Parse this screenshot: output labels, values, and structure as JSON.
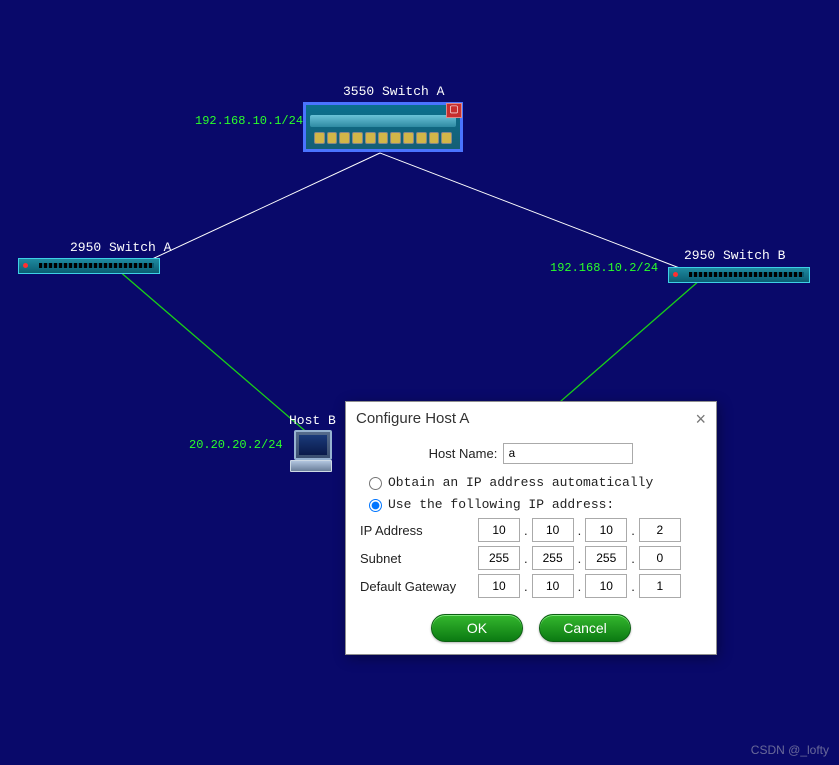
{
  "devices": {
    "sw3550": {
      "label": "3550 Switch A",
      "ip_label": "192.168.10.1/24"
    },
    "sw2950a": {
      "label": "2950 Switch A"
    },
    "sw2950b": {
      "label": "2950 Switch B",
      "ip_label": "192.168.10.2/24"
    },
    "hostb": {
      "label": "Host B",
      "ip_label": "20.20.20.2/24"
    }
  },
  "dialog": {
    "title": "Configure Host A",
    "hostname_label": "Host Name:",
    "hostname_value": "a",
    "radio_auto": "Obtain an IP address automatically",
    "radio_static": "Use the following IP address:",
    "ip_label": "IP Address",
    "subnet_label": "Subnet",
    "gateway_label": "Default Gateway",
    "ip": [
      "10",
      "10",
      "10",
      "2"
    ],
    "subnet": [
      "255",
      "255",
      "255",
      "0"
    ],
    "gateway": [
      "10",
      "10",
      "10",
      "1"
    ],
    "ok": "OK",
    "cancel": "Cancel"
  },
  "watermark": "CSDN @_lofty"
}
